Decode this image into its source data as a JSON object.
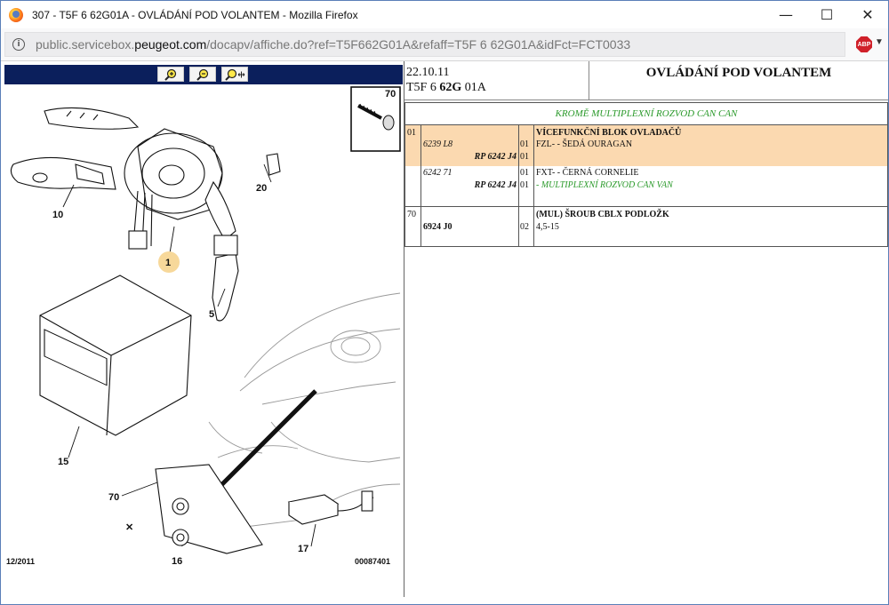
{
  "window": {
    "title": "307 - T5F 6 62G01A - OVLÁDÁNÍ POD VOLANTEM - Mozilla Firefox",
    "minimize_glyph": "—",
    "maximize_glyph": "☐",
    "close_glyph": "✕"
  },
  "urlbar": {
    "info_glyph": "i",
    "url_pre": "public.servicebox.",
    "url_domain": "peugeot.com",
    "url_post": "/docapv/affiche.do?ref=T5F662G01A&refaff=T5F 6 62G01A&idFct=FCT0033",
    "abp_label": "ABP",
    "abp_caret": "▼"
  },
  "drawing": {
    "callouts": [
      "70",
      "20",
      "10",
      "1",
      "5",
      "15",
      "70",
      "16",
      "17"
    ],
    "footer_left": "12/2011",
    "footer_right": "00087401"
  },
  "doc": {
    "date": "22.10.11",
    "ref_prefix": "T5F 6 ",
    "ref_bold": "62G",
    "ref_suffix": " 01A",
    "title": "OVLÁDÁNÍ POD VOLANTEM"
  },
  "parts": {
    "condition": "KROMĚ MULTIPLEXNÍ ROZVOD CAN CAN",
    "groups": [
      {
        "item": "01",
        "lines": [
          {
            "ref": "",
            "sub": "",
            "qty": "",
            "desc": "VÍCEFUNKČNÍ BLOK OVLADAČŮ"
          },
          {
            "ref": "6239 L8",
            "sub": "",
            "qty": "01",
            "desc": "FZL- - ŠEDÁ OURAGAN"
          },
          {
            "ref": "",
            "sub": "RP 6242 J4",
            "qty": "01",
            "desc": ""
          },
          {
            "ref": "6242 71",
            "sub": "",
            "qty": "01",
            "desc": "FXT- - ČERNÁ CORNELIE"
          },
          {
            "ref": "",
            "sub": "RP 6242 J4",
            "qty": "01",
            "desc": "- MULTIPLEXNÍ ROZVOD CAN VAN"
          }
        ]
      },
      {
        "item": "70",
        "lines": [
          {
            "ref": "",
            "sub": "",
            "qty": "",
            "desc": "(MUL) ŠROUB CBLX PODLOŽK"
          },
          {
            "ref": "6924 J0",
            "sub": "",
            "qty": "02",
            "desc": "4,5-15"
          }
        ]
      }
    ]
  },
  "colors": {
    "highlight_row": "#fbd9b0",
    "toolbar_blue": "#0b1f5c",
    "condition_green": "#2b9a2b",
    "callout_circle": "#f7d89a"
  }
}
